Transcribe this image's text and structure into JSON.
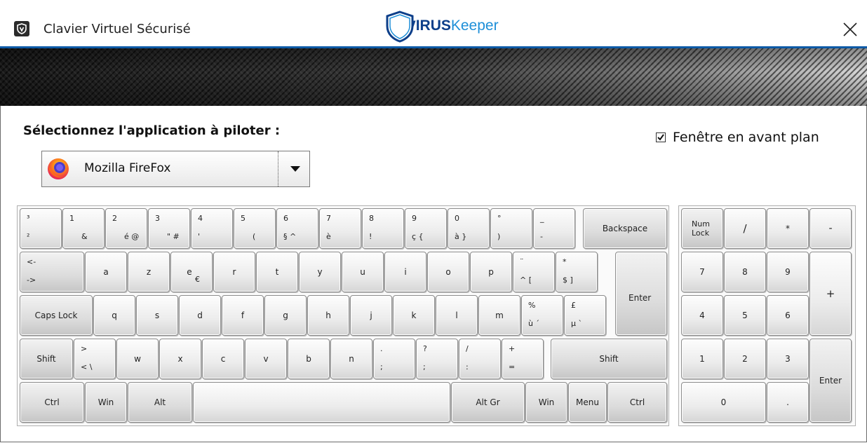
{
  "window": {
    "title": "Clavier Virtuel Sécurisé",
    "close_glyph": "✕",
    "brand": {
      "v": "V",
      "irus": "IRUS",
      "keeper": "Keeper"
    }
  },
  "colors": {
    "accent": "#0d5aa6",
    "brand_dark": "#0d3f8a",
    "brand_light": "#1e8fd8"
  },
  "selector": {
    "label": "Sélectionnez l'application à piloter :",
    "selected_app": "Mozilla FireFox",
    "app_icon": "firefox-icon"
  },
  "foreground": {
    "label": "Fenêtre en avant plan",
    "checked": true
  },
  "keyboard": {
    "row1": [
      {
        "top": "³",
        "bottom": "²"
      },
      {
        "top": "1",
        "bottom": "&"
      },
      {
        "top": "2",
        "bottom": "é @"
      },
      {
        "top": "3",
        "bottom": "\" #"
      },
      {
        "top": "4",
        "bottom": "'"
      },
      {
        "top": "5",
        "bottom": "("
      },
      {
        "top": "6",
        "bottom": "§ ^"
      },
      {
        "top": "7",
        "bottom": "è"
      },
      {
        "top": "8",
        "bottom": "!"
      },
      {
        "top": "9",
        "bottom": "ç {"
      },
      {
        "top": "0",
        "bottom": "à }"
      },
      {
        "top": "°",
        "bottom": ")"
      },
      {
        "top": "_",
        "bottom": "-"
      }
    ],
    "backspace": "Backspace",
    "tab_top": "<-",
    "tab_bottom": "->",
    "row2": [
      "a",
      "z",
      "e",
      "r",
      "t",
      "y",
      "u",
      "i",
      "o",
      "p"
    ],
    "euro": "€",
    "row2_extra": [
      {
        "top": "¨",
        "bottom": "^ ["
      },
      {
        "top": "*",
        "bottom": "$ ]"
      }
    ],
    "enter": "Enter",
    "caps": "Caps Lock",
    "row3": [
      "q",
      "s",
      "d",
      "f",
      "g",
      "h",
      "j",
      "k",
      "l",
      "m"
    ],
    "row3_extra": [
      {
        "top": "%",
        "bottom": "ù ´"
      },
      {
        "top": "£",
        "bottom": "µ `"
      }
    ],
    "shift": "Shift",
    "lt_key": {
      "top": ">",
      "bottom": "< \\"
    },
    "row4": [
      "w",
      "x",
      "c",
      "v",
      "b",
      "n"
    ],
    "row4_extra": [
      {
        "top": ".",
        "bottom": ";"
      },
      {
        "top": "?",
        "bottom": ";"
      },
      {
        "top": "/",
        "bottom": ":"
      },
      {
        "top": "+",
        "bottom": "="
      }
    ],
    "ctrl": "Ctrl",
    "win": "Win",
    "alt": "Alt",
    "altgr": "Alt Gr",
    "menu": "Menu"
  },
  "numpad": {
    "numlock": "Num Lock",
    "keys": [
      "/",
      "*",
      "-",
      "7",
      "8",
      "9",
      "+",
      "4",
      "5",
      "6",
      "1",
      "2",
      "3",
      "Enter",
      "0",
      "."
    ]
  }
}
